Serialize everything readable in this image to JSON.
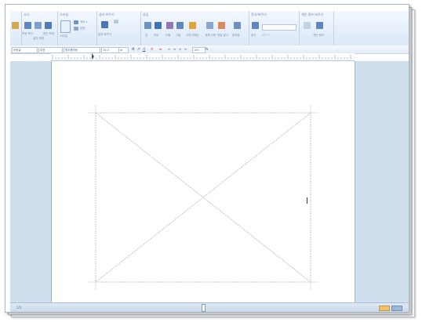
{
  "ribbon": {
    "groups": [
      {
        "id": "g0",
        "label": ""
      },
      {
        "id": "g1",
        "label": "서식"
      },
      {
        "id": "g2",
        "label": "스타일"
      },
      {
        "id": "g3",
        "label": "글자 바꾸기"
      },
      {
        "id": "g4",
        "label": "삽입"
      },
      {
        "id": "g5",
        "label": "찾기/바꾸기"
      },
      {
        "id": "g6",
        "label": "개인 정보 바꾸기"
      }
    ],
    "buttons": [
      {
        "label": "모양 복사"
      },
      {
        "label": "글자 모양"
      },
      {
        "label": "문단 모양"
      },
      {
        "label": "스타일"
      },
      {
        "label": "개요 1"
      },
      {
        "label": "본문"
      },
      {
        "label": "글자 바꾸기"
      },
      {
        "label": "표"
      },
      {
        "label": "차트"
      },
      {
        "label": "도형"
      },
      {
        "label": "그림"
      },
      {
        "label": "그리기마당"
      },
      {
        "label": "개체 선택"
      },
      {
        "label": "덧말 넣기"
      },
      {
        "label": "문자표"
      },
      {
        "label": "찾기"
      },
      {
        "label": "바꾸기"
      },
      {
        "label": "개인 정보"
      }
    ],
    "search_placeholder": ""
  },
  "toolbar": {
    "style_value": "바탕글",
    "lang_value": "대표",
    "font_value": "함초롬바탕",
    "size_value": "10.0",
    "unit_value": "pt",
    "percent_value": "100",
    "misc_value": "%"
  },
  "status": {
    "page_label": "1/1",
    "zoom": ""
  }
}
